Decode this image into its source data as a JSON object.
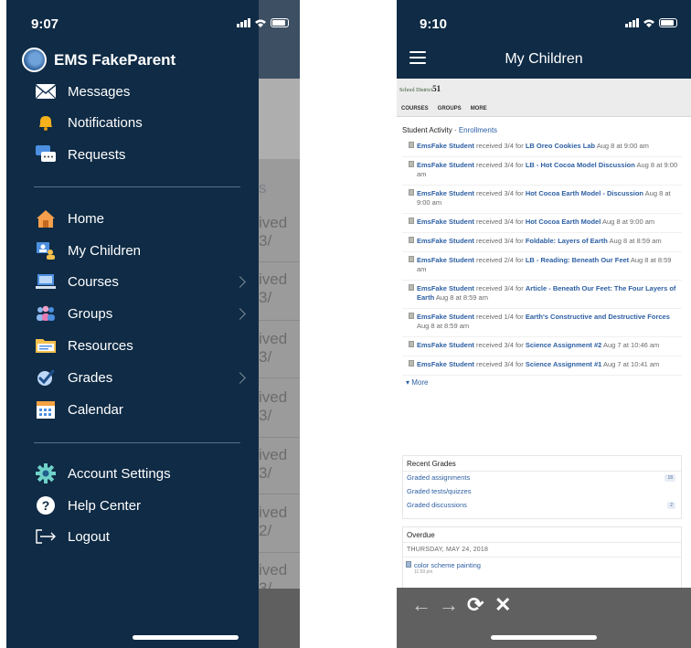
{
  "left": {
    "status": {
      "time": "9:07"
    },
    "profile": {
      "name": "EMS FakeParent"
    },
    "menu_top": [
      {
        "label": "Messages",
        "icon": "envelope-icon"
      },
      {
        "label": "Notifications",
        "icon": "bell-icon"
      },
      {
        "label": "Requests",
        "icon": "chat-bubble-icon"
      }
    ],
    "menu_main": [
      {
        "label": "Home",
        "icon": "home-icon",
        "chevron": false
      },
      {
        "label": "My Children",
        "icon": "children-icon",
        "chevron": false
      },
      {
        "label": "Courses",
        "icon": "laptop-icon",
        "chevron": true
      },
      {
        "label": "Groups",
        "icon": "people-icon",
        "chevron": true
      },
      {
        "label": "Resources",
        "icon": "folder-icon",
        "chevron": false
      },
      {
        "label": "Grades",
        "icon": "checkmark-icon",
        "chevron": true
      },
      {
        "label": "Calendar",
        "icon": "calendar-icon",
        "chevron": false
      }
    ],
    "menu_bottom": [
      {
        "label": "Account Settings",
        "icon": "gear-icon"
      },
      {
        "label": "Help Center",
        "icon": "help-icon"
      },
      {
        "label": "Logout",
        "icon": "logout-icon"
      }
    ],
    "background": {
      "section_label": "s",
      "rows": [
        "ived 3/",
        "ived 3/",
        "ived 3/",
        "ived 3/",
        "ived 3/",
        "ived 2/",
        "ived 3/"
      ]
    }
  },
  "right": {
    "status": {
      "time": "9:10"
    },
    "nav": {
      "title": "My Children"
    },
    "school": {
      "logo_text": "School District",
      "logo_num": "51"
    },
    "tabs": [
      "COURSES",
      "GROUPS",
      "MORE"
    ],
    "activity": {
      "title": "Student Activity",
      "separator": " · ",
      "link": "Enrollments",
      "items": [
        {
          "who": "EmsFake Student",
          "score": " received 3/4 for ",
          "item": "LB Oreo Cookies Lab",
          "date": "Aug 8 at 9:00 am"
        },
        {
          "who": "EmsFake Student",
          "score": " received 3/4 for ",
          "item": "LB - Hot Cocoa Model Discussion",
          "date": "Aug 8 at 9:00 am"
        },
        {
          "who": "EmsFake Student",
          "score": " received 3/4 for ",
          "item": "Hot Cocoa Earth Model - Discussion",
          "date": "Aug 8 at 9:00 am"
        },
        {
          "who": "EmsFake Student",
          "score": " received 3/4 for ",
          "item": "Hot Cocoa Earth Model",
          "date": "Aug 8 at 9:00 am"
        },
        {
          "who": "EmsFake Student",
          "score": " received 3/4 for ",
          "item": "Foldable: Layers of Earth",
          "date": "Aug 8 at 8:59 am"
        },
        {
          "who": "EmsFake Student",
          "score": " received 2/4 for ",
          "item": "LB - Reading: Beneath Our Feet",
          "date": "Aug 8 at 8:59 am"
        },
        {
          "who": "EmsFake Student",
          "score": " received 3/4 for ",
          "item": "Article - Beneath Our Feet: The Four Layers of Earth",
          "date": "Aug 8 at 8:59 am"
        },
        {
          "who": "EmsFake Student",
          "score": " received 1/4 for ",
          "item": "Earth's Constructive and Destructive Forces",
          "date": "Aug 8 at 8:59 am"
        },
        {
          "who": "EmsFake Student",
          "score": " received 3/4 for ",
          "item": "Science Assignment #2",
          "date": "Aug 7 at 10:46 am"
        },
        {
          "who": "EmsFake Student",
          "score": " received 3/4 for ",
          "item": "Science Assignment #1",
          "date": "Aug 7 at 10:41 am"
        }
      ],
      "more": "More"
    },
    "recent_grades": {
      "title": "Recent Grades",
      "rows": [
        {
          "label": "Graded assignments",
          "count": "18"
        },
        {
          "label": "Graded tests/quizzes",
          "count": ""
        },
        {
          "label": "Graded discussions",
          "count": "2"
        }
      ]
    },
    "overdue": {
      "title": "Overdue",
      "date": "THURSDAY, MAY 24, 2018",
      "item": "color scheme painting",
      "time": "11:59 pm"
    },
    "toolbar": {
      "back": "←",
      "forward": "→",
      "reload": "⟳",
      "close": "✕"
    }
  }
}
